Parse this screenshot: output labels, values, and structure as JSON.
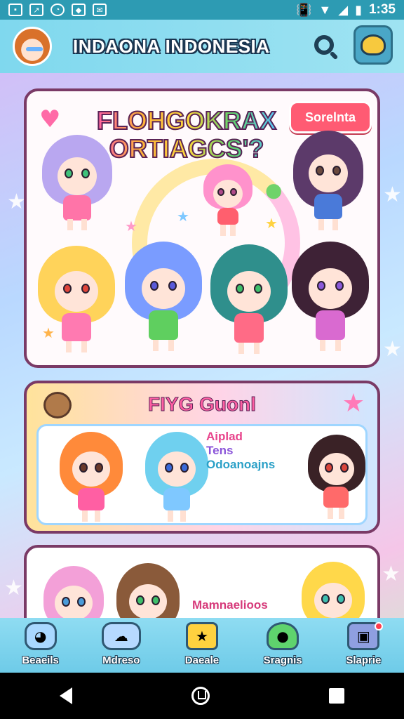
{
  "status_bar": {
    "time": "1:35"
  },
  "header": {
    "title": "INDAONA INDONESIA"
  },
  "hero": {
    "title_line1": "FLOHGOKRAX",
    "title_line2": "ORTIAGCS'?",
    "tag_label": "Sorelnta"
  },
  "featured": {
    "title": "FIYG Guonl",
    "lines": [
      "Aiplad",
      "Tens",
      "Odoanoajns"
    ]
  },
  "more": {
    "title": "Mamnaelioos",
    "dots": "..."
  },
  "bottom_nav": {
    "items": [
      {
        "label": "Beaeils",
        "icon": "cloud-face-icon",
        "color": "#a9d8ff"
      },
      {
        "label": "Mdreso",
        "icon": "cloud-chat-icon",
        "color": "#b6d9ff"
      },
      {
        "label": "Daeale",
        "icon": "star-face-icon",
        "color": "#ffd23f"
      },
      {
        "label": "Sragnis",
        "icon": "slime-icon",
        "color": "#5fd36d"
      },
      {
        "label": "Slaprie",
        "icon": "box-notification-icon",
        "color": "#8f9fe0"
      }
    ]
  },
  "colors": {
    "accent": "#ff5fa8",
    "header_bg": "#7fd8ee",
    "card_border": "#7a3a66"
  }
}
